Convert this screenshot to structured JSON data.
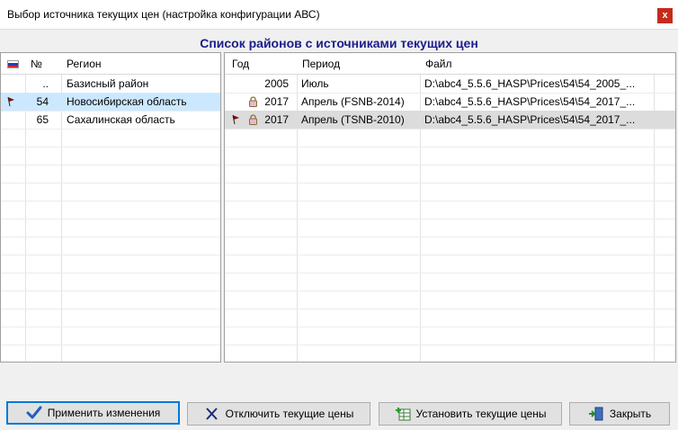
{
  "window": {
    "title": "Выбор источника текущих цен (настройка конфигурации АВС)",
    "close_glyph": "x"
  },
  "header": {
    "title": "Список районов с источниками текущих цен"
  },
  "regions": {
    "columns": {
      "num": "№",
      "region": "Регион"
    },
    "rows": [
      {
        "num": "..",
        "name": "Базисный район",
        "flag": false,
        "selected": false
      },
      {
        "num": "54",
        "name": "Новосибирская область",
        "flag": true,
        "selected": true
      },
      {
        "num": "65",
        "name": "Сахалинская область",
        "flag": false,
        "selected": false
      }
    ]
  },
  "sources": {
    "columns": {
      "year": "Год",
      "period": "Период",
      "file": "Файл"
    },
    "rows": [
      {
        "year": "2005",
        "period": "Июль",
        "file": "D:\\abc4_5.5.6_HASP\\Prices\\54\\54_2005_...",
        "flag": false,
        "locked": false,
        "selected": false
      },
      {
        "year": "2017",
        "period": "Апрель (FSNB-2014)",
        "file": "D:\\abc4_5.5.6_HASP\\Prices\\54\\54_2017_...",
        "flag": false,
        "locked": true,
        "selected": false
      },
      {
        "year": "2017",
        "period": "Апрель (TSNB-2010)",
        "file": "D:\\abc4_5.5.6_HASP\\Prices\\54\\54_2017_...",
        "flag": true,
        "locked": true,
        "selected": true
      }
    ]
  },
  "buttons": {
    "apply": "Применить изменения",
    "disable": "Отключить текущие цены",
    "install": "Установить текущие цены",
    "close": "Закрыть"
  },
  "colors": {
    "header_text": "#1c1c8c",
    "selection_light": "#cce8ff",
    "selection_gray": "#dcdcdc",
    "close_button": "#c42b1c",
    "pennant": "#8b0000",
    "primary_border": "#0078d7"
  },
  "icons": {
    "flag": "russian-flag-icon",
    "active_marker": "pennant-icon",
    "lock": "lock-icon",
    "apply": "checkmark-icon",
    "disable": "x-cross-icon",
    "install": "table-plus-icon",
    "close": "door-exit-icon"
  }
}
